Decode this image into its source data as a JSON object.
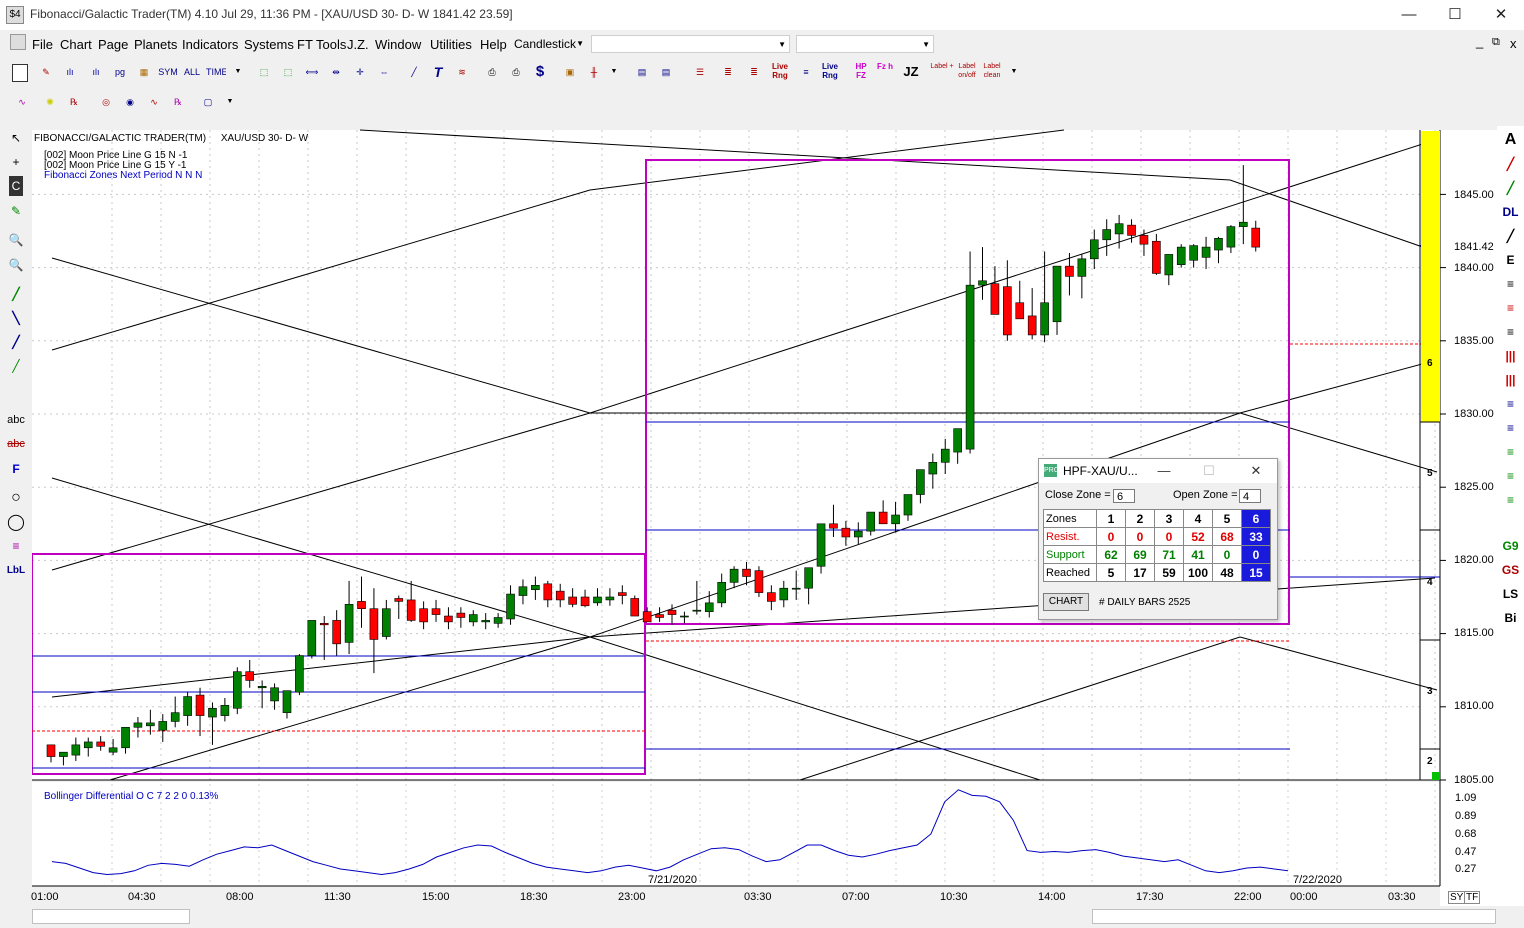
{
  "window": {
    "title": "Fibonacci/Galactic Trader(TM) 4.10 Jul 29,  11:36 PM - [XAU/USD 30- D- W 1841.42    23.59]",
    "app_icon": "$4",
    "minimize": "—",
    "maximize": "☐",
    "close": "✕"
  },
  "menu": {
    "items": [
      "File",
      "Chart",
      "Page",
      "Planets",
      "Indicators",
      "Systems",
      "FT Tools",
      "J.Z.",
      "Window",
      "Utilities",
      "Help"
    ],
    "chart_type": "Candlestick",
    "combo2": "",
    "combo3": "",
    "mdi_controls": [
      "_",
      "⧉",
      "x"
    ]
  },
  "toolbar1": [
    "SYM",
    "ALL",
    "TIME",
    "Live Rng",
    "Live Rng",
    "HP FZ",
    "Fz h",
    "JZ",
    "Label +",
    "Label on/off",
    "Label clean"
  ],
  "chart_header": {
    "left": "FIBONACCI/GALACTIC TRADER(TM)",
    "symbol": "XAU/USD 30- D- W"
  },
  "legend": {
    "line1": "[002] Moon Price Line G 15 N -1",
    "line2": "[002] Moon Price Line G 15 Y -1",
    "line3": "Fibonacci Zones Next Period N N N"
  },
  "price_axis": {
    "labels": [
      "1845.00",
      "1840.00",
      "1835.00",
      "1830.00",
      "1825.00",
      "1820.00",
      "1815.00",
      "1810.00",
      "1805.00"
    ],
    "current": "1841.42",
    "zone_numbers": [
      "6",
      "5",
      "4",
      "3",
      "2"
    ]
  },
  "indicator": {
    "label": "Bollinger Differential O C 7 2 2 0  0.13%",
    "axis": [
      "1.09",
      "0.89",
      "0.68",
      "0.47",
      "0.27"
    ]
  },
  "time_axis": {
    "labels": [
      "01:00",
      "04:30",
      "08:00",
      "11:30",
      "15:00",
      "18:30",
      "23:00",
      "03:30",
      "07:00",
      "10:30",
      "14:00",
      "17:30",
      "22:00",
      "00:00",
      "03:30"
    ],
    "dates": [
      "7/21/2020",
      "7/22/2020"
    ],
    "buttons": [
      "SY",
      "TF"
    ]
  },
  "popup": {
    "title": "HPF-XAU/U...",
    "close_zone_label": "Close Zone =",
    "close_zone": "6",
    "open_zone_label": "Open Zone =",
    "open_zone": "4",
    "headers": [
      "Zones",
      "1",
      "2",
      "3",
      "4",
      "5",
      "6"
    ],
    "rows": [
      {
        "label": "Resist.",
        "values": [
          "0",
          "0",
          "0",
          "52",
          "68",
          "33"
        ]
      },
      {
        "label": "Support",
        "values": [
          "62",
          "69",
          "71",
          "41",
          "0",
          "0"
        ]
      },
      {
        "label": "Reached",
        "values": [
          "5",
          "17",
          "59",
          "100",
          "48",
          "15"
        ]
      }
    ],
    "chart_button": "CHART",
    "daily_bars": "# DAILY BARS 2525"
  },
  "left_tools": [
    "↖",
    "+",
    "C",
    "✎",
    "🔍",
    "🔍",
    "╱",
    "╲",
    "╱",
    "╱",
    "abc",
    "abc",
    "F",
    "○",
    "◯",
    "≡",
    "LbL"
  ],
  "right_tools": [
    "A",
    "╱",
    "╱",
    "DL",
    "╱",
    "E",
    "≡",
    "≡",
    "≡",
    "|||",
    "|||",
    "≡",
    "≡",
    "≡",
    "≡",
    "≡",
    "G9",
    "GS",
    "LS",
    "Bi"
  ],
  "colors": {
    "up_candle": "#008000",
    "down_candle": "#ff0000",
    "zone_box": "#c000c0",
    "zone_line": "#0000c0",
    "price_label_bg": "#ffff00",
    "indicator_line": "#0000c0"
  },
  "chart_data": {
    "type": "candlestick",
    "symbol": "XAU/USD",
    "interval": "30 min",
    "ylim": [
      1805,
      1849
    ],
    "candles": [
      [
        1807.4,
        1807.4,
        1806.2,
        1806.6
      ],
      [
        1806.6,
        1806.8,
        1806.0,
        1806.9
      ],
      [
        1806.7,
        1807.9,
        1806.3,
        1807.4
      ],
      [
        1807.2,
        1807.9,
        1806.6,
        1807.6
      ],
      [
        1807.6,
        1808.0,
        1807.0,
        1807.3
      ],
      [
        1806.9,
        1807.8,
        1806.7,
        1807.2
      ],
      [
        1807.2,
        1808.6,
        1806.8,
        1808.6
      ],
      [
        1808.6,
        1809.3,
        1807.9,
        1808.9
      ],
      [
        1808.7,
        1809.8,
        1808.1,
        1808.9
      ],
      [
        1808.4,
        1809.5,
        1807.6,
        1809.0
      ],
      [
        1809.0,
        1810.7,
        1808.6,
        1809.6
      ],
      [
        1809.4,
        1811.0,
        1808.7,
        1810.7
      ],
      [
        1810.8,
        1811.3,
        1808.0,
        1809.4
      ],
      [
        1809.3,
        1810.3,
        1807.4,
        1809.9
      ],
      [
        1809.4,
        1810.6,
        1809.0,
        1810.1
      ],
      [
        1809.9,
        1812.7,
        1809.5,
        1812.4
      ],
      [
        1812.4,
        1813.2,
        1811.3,
        1811.8
      ],
      [
        1811.3,
        1811.8,
        1809.9,
        1811.4
      ],
      [
        1810.4,
        1811.6,
        1809.8,
        1811.3
      ],
      [
        1809.6,
        1811.1,
        1809.2,
        1811.1
      ],
      [
        1811.0,
        1813.6,
        1810.8,
        1813.5
      ],
      [
        1813.5,
        1815.7,
        1813.3,
        1815.9
      ],
      [
        1815.7,
        1816.2,
        1813.2,
        1815.6
      ],
      [
        1815.9,
        1816.6,
        1813.5,
        1814.3
      ],
      [
        1814.4,
        1818.6,
        1813.6,
        1817.0
      ],
      [
        1817.2,
        1818.9,
        1815.4,
        1816.7
      ],
      [
        1816.7,
        1818.1,
        1812.3,
        1814.6
      ],
      [
        1814.8,
        1817.3,
        1814.6,
        1816.7
      ],
      [
        1817.4,
        1817.6,
        1816.0,
        1817.2
      ],
      [
        1817.3,
        1818.6,
        1815.8,
        1815.9
      ],
      [
        1816.7,
        1817.2,
        1815.3,
        1815.8
      ],
      [
        1816.7,
        1817.3,
        1815.8,
        1816.3
      ],
      [
        1816.2,
        1816.8,
        1815.3,
        1815.8
      ],
      [
        1816.4,
        1816.8,
        1815.4,
        1816.1
      ],
      [
        1815.8,
        1816.6,
        1815.5,
        1816.3
      ],
      [
        1815.8,
        1816.4,
        1815.3,
        1815.9
      ],
      [
        1815.7,
        1816.4,
        1815.4,
        1816.1
      ],
      [
        1816.0,
        1818.3,
        1815.6,
        1817.7
      ],
      [
        1817.6,
        1818.7,
        1817.0,
        1818.2
      ],
      [
        1818.0,
        1818.9,
        1817.3,
        1818.3
      ],
      [
        1818.4,
        1818.6,
        1816.8,
        1817.3
      ],
      [
        1817.9,
        1818.4,
        1816.8,
        1817.3
      ],
      [
        1817.5,
        1818.1,
        1816.8,
        1817.0
      ],
      [
        1817.5,
        1818.0,
        1816.8,
        1816.9
      ],
      [
        1817.1,
        1818.1,
        1816.9,
        1817.5
      ],
      [
        1817.3,
        1818.1,
        1816.9,
        1817.5
      ],
      [
        1817.8,
        1818.3,
        1817.0,
        1817.6
      ],
      [
        1817.4,
        1817.6,
        1816.2,
        1816.2
      ],
      [
        1816.5,
        1816.8,
        1815.8,
        1815.8
      ],
      [
        1816.3,
        1816.8,
        1815.8,
        1816.1
      ],
      [
        1816.6,
        1817.0,
        1815.6,
        1816.3
      ],
      [
        1816.2,
        1816.5,
        1815.7,
        1816.2
      ],
      [
        1816.6,
        1818.6,
        1816.3,
        1816.6
      ],
      [
        1816.5,
        1817.9,
        1816.1,
        1817.1
      ],
      [
        1817.1,
        1819.1,
        1816.8,
        1818.5
      ],
      [
        1818.5,
        1819.6,
        1818.1,
        1819.4
      ],
      [
        1819.4,
        1819.9,
        1818.3,
        1818.9
      ],
      [
        1819.3,
        1819.6,
        1817.5,
        1817.8
      ],
      [
        1817.8,
        1818.3,
        1816.6,
        1817.2
      ],
      [
        1817.3,
        1818.6,
        1816.8,
        1818.1
      ],
      [
        1818.1,
        1819.3,
        1817.3,
        1818.1
      ],
      [
        1818.1,
        1819.4,
        1817.0,
        1819.5
      ],
      [
        1819.6,
        1821.4,
        1819.1,
        1822.5
      ],
      [
        1822.5,
        1823.8,
        1821.6,
        1822.2
      ],
      [
        1822.2,
        1822.7,
        1821.0,
        1821.6
      ],
      [
        1821.6,
        1822.6,
        1821.1,
        1822.0
      ],
      [
        1822.0,
        1823.1,
        1821.7,
        1823.3
      ],
      [
        1823.3,
        1824.1,
        1822.5,
        1822.5
      ],
      [
        1822.5,
        1824.0,
        1821.9,
        1823.1
      ],
      [
        1823.1,
        1824.4,
        1822.7,
        1824.5
      ],
      [
        1824.5,
        1825.9,
        1823.9,
        1826.2
      ],
      [
        1825.9,
        1827.3,
        1824.9,
        1826.7
      ],
      [
        1826.7,
        1828.3,
        1825.9,
        1827.6
      ],
      [
        1827.4,
        1828.5,
        1826.6,
        1829.0
      ],
      [
        1827.6,
        1841.1,
        1827.3,
        1838.8
      ],
      [
        1838.8,
        1841.4,
        1837.8,
        1839.1
      ],
      [
        1838.9,
        1840.1,
        1836.9,
        1836.8
      ],
      [
        1838.7,
        1840.5,
        1835.0,
        1835.4
      ],
      [
        1837.6,
        1839.1,
        1836.7,
        1836.5
      ],
      [
        1836.7,
        1838.6,
        1835.1,
        1835.4
      ],
      [
        1835.4,
        1841.1,
        1834.9,
        1837.6
      ],
      [
        1836.3,
        1840.1,
        1835.4,
        1840.1
      ],
      [
        1840.1,
        1841.0,
        1838.1,
        1839.4
      ],
      [
        1839.4,
        1840.9,
        1837.9,
        1840.6
      ],
      [
        1840.6,
        1842.6,
        1839.9,
        1841.9
      ],
      [
        1841.9,
        1843.3,
        1840.8,
        1842.6
      ],
      [
        1842.3,
        1843.6,
        1841.3,
        1843.0
      ],
      [
        1842.9,
        1843.3,
        1841.7,
        1842.2
      ],
      [
        1842.2,
        1842.6,
        1840.8,
        1841.6
      ],
      [
        1841.8,
        1842.3,
        1839.5,
        1839.6
      ],
      [
        1839.5,
        1840.8,
        1838.8,
        1840.9
      ],
      [
        1840.2,
        1841.6,
        1840.0,
        1841.4
      ],
      [
        1840.5,
        1841.6,
        1840.0,
        1841.5
      ],
      [
        1840.7,
        1842.1,
        1839.9,
        1841.4
      ],
      [
        1841.2,
        1842.1,
        1840.3,
        1842.0
      ],
      [
        1841.4,
        1842.9,
        1841.0,
        1842.8
      ],
      [
        1842.8,
        1847.0,
        1841.6,
        1843.1
      ],
      [
        1842.7,
        1843.2,
        1841.1,
        1841.4
      ]
    ],
    "current_price": 1841.42,
    "indicator_series": [
      0.4,
      0.38,
      0.33,
      0.28,
      0.26,
      0.27,
      0.3,
      0.36,
      0.38,
      0.37,
      0.35,
      0.42,
      0.48,
      0.52,
      0.56,
      0.55,
      0.58,
      0.52,
      0.46,
      0.4,
      0.36,
      0.32,
      0.3,
      0.28,
      0.26,
      0.28,
      0.32,
      0.37,
      0.45,
      0.5,
      0.55,
      0.58,
      0.57,
      0.5,
      0.44,
      0.38,
      0.34,
      0.32,
      0.3,
      0.28,
      0.3,
      0.34,
      0.36,
      0.33,
      0.3,
      0.34,
      0.42,
      0.48,
      0.54,
      0.55,
      0.53,
      0.46,
      0.4,
      0.42,
      0.5,
      0.58,
      0.58,
      0.52,
      0.47,
      0.45,
      0.48,
      0.52,
      0.55,
      0.58,
      0.7,
      1.05,
      1.18,
      1.12,
      1.11,
      1.05,
      0.85,
      0.52,
      0.5,
      0.51,
      0.5,
      0.52,
      0.53,
      0.5,
      0.46,
      0.44,
      0.42,
      0.4,
      0.42,
      0.36,
      0.3,
      0.28,
      0.3,
      0.33,
      0.34,
      0.32,
      0.3
    ]
  }
}
